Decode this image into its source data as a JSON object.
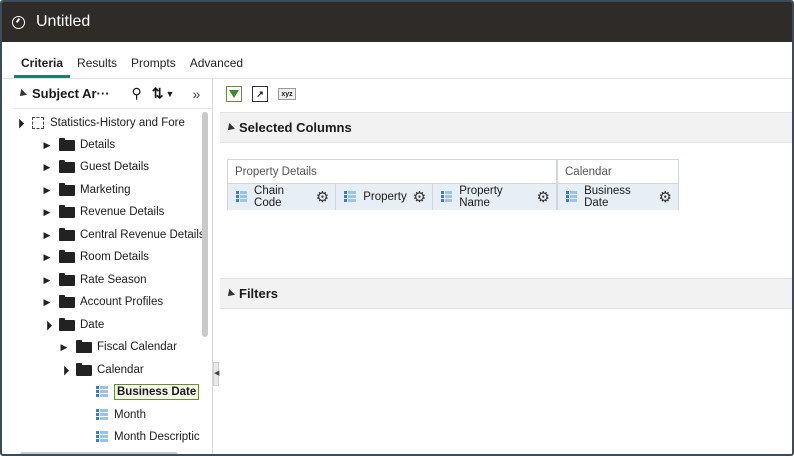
{
  "window": {
    "title": "Untitled"
  },
  "tabs": [
    {
      "label": "Criteria",
      "active": true
    },
    {
      "label": "Results",
      "active": false
    },
    {
      "label": "Prompts",
      "active": false
    },
    {
      "label": "Advanced",
      "active": false
    }
  ],
  "subject_area": {
    "title": "Subject Ar···",
    "icons": [
      "search-icon",
      "sort-icon",
      "expand-pane-icon"
    ],
    "tree": [
      {
        "label": "Statistics-History and Fore",
        "type": "root",
        "expanded": true
      },
      {
        "label": "Details",
        "type": "folder",
        "expanded": false
      },
      {
        "label": "Guest Details",
        "type": "folder",
        "expanded": false
      },
      {
        "label": "Marketing",
        "type": "folder",
        "expanded": false
      },
      {
        "label": "Revenue Details",
        "type": "folder",
        "expanded": false
      },
      {
        "label": "Central Revenue Details",
        "type": "folder",
        "expanded": false
      },
      {
        "label": "Room Details",
        "type": "folder",
        "expanded": false
      },
      {
        "label": "Rate Season",
        "type": "folder",
        "expanded": false
      },
      {
        "label": "Account Profiles",
        "type": "folder",
        "expanded": false
      },
      {
        "label": "Date",
        "type": "folder",
        "expanded": true
      },
      {
        "label": "Fiscal Calendar",
        "type": "folder",
        "expanded": false
      },
      {
        "label": "Calendar",
        "type": "folder",
        "expanded": true
      },
      {
        "label": "Business Date",
        "type": "column",
        "selected": true
      },
      {
        "label": "Month",
        "type": "column"
      },
      {
        "label": "Month Descriptic",
        "type": "column"
      }
    ]
  },
  "toolbar": {
    "icons": [
      "filter-icon",
      "chart-icon",
      "xyz-icon"
    ],
    "xyz_label": "xyz"
  },
  "selected_columns": {
    "title": "Selected Columns",
    "groups": [
      {
        "name": "Property Details",
        "columns": [
          "Chain Code",
          "Property",
          "Property Name"
        ]
      },
      {
        "name": "Calendar",
        "columns": [
          "Business Date"
        ]
      }
    ]
  },
  "filters": {
    "title": "Filters"
  },
  "colors": {
    "titlebar": "#2f2b28",
    "active_tab": "#1f7a7a",
    "chip_bg": "#e8eef5"
  }
}
